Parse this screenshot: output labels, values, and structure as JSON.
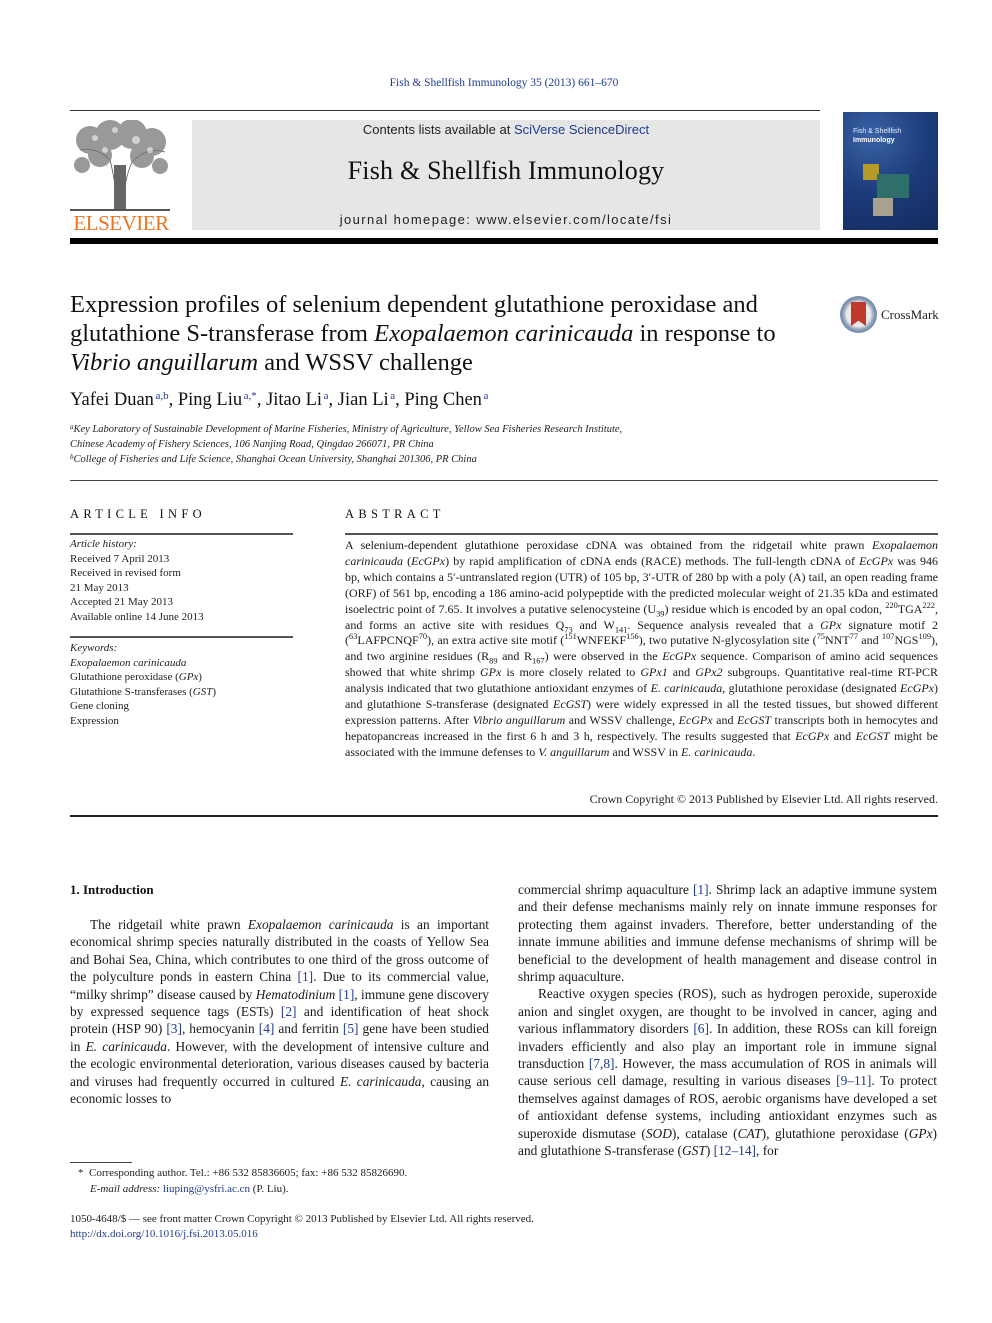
{
  "running_head": "Fish & Shellfish Immunology 35 (2013) 661–670",
  "masthead": {
    "publisher": "ELSEVIER",
    "contents_prefix": "Contents lists available at ",
    "contents_link": "SciVerse ScienceDirect",
    "journal_title": "Fish & Shellfish Immunology",
    "homepage": "journal homepage: www.elsevier.com/locate/fsi",
    "cover_title_line1": "Fish & Shellfish",
    "cover_title_line2": "Immunology"
  },
  "colors": {
    "link": "#1f3b8c",
    "elsevier_orange": "#e87722",
    "masthead_bg": "#e6e6e6",
    "crossmark_red": "#c0392b"
  },
  "crossmark_label": "CrossMark",
  "title": {
    "part1": "Expression profiles of selenium dependent glutathione peroxidase and glutathione S-transferase from ",
    "species1": "Exopalaemon carinicauda",
    "part2": " in response to ",
    "species2": "Vibrio anguillarum",
    "part3": " and WSSV challenge"
  },
  "authors": [
    {
      "name": "Yafei Duan",
      "aff": "a,b"
    },
    {
      "name": "Ping Liu",
      "aff": "a,*"
    },
    {
      "name": "Jitao Li",
      "aff": "a"
    },
    {
      "name": "Jian Li",
      "aff": "a"
    },
    {
      "name": "Ping Chen",
      "aff": "a"
    }
  ],
  "affiliations": [
    {
      "mark": "a",
      "line1": "Key Laboratory of Sustainable Development of Marine Fisheries, Ministry of Agriculture, Yellow Sea Fisheries Research Institute,",
      "line2": "Chinese Academy of Fishery Sciences, 106 Nanjing Road, Qingdao 266071, PR China"
    },
    {
      "mark": "b",
      "line1": "College of Fisheries and Life Science, Shanghai Ocean University, Shanghai 201306, PR China"
    }
  ],
  "article_info": {
    "heading": "ARTICLE INFO",
    "history_label": "Article history:",
    "history": [
      "Received 7 April 2013",
      "Received in revised form",
      "21 May 2013",
      "Accepted 21 May 2013",
      "Available online 14 June 2013"
    ],
    "keywords_label": "Keywords:",
    "keywords": [
      {
        "text": "Exopalaemon carinicauda",
        "italic": true
      },
      {
        "text": "Glutathione peroxidase (",
        "abbr": "GPx",
        "close": ")"
      },
      {
        "text": "Glutathione S-transferases (",
        "abbr": "GST",
        "close": ")"
      },
      {
        "text": "Gene cloning"
      },
      {
        "text": "Expression"
      }
    ]
  },
  "abstract": {
    "heading": "ABSTRACT",
    "html": "A selenium-dependent glutathione peroxidase cDNA was obtained from the ridgetail white prawn <i>Exopalaemon carinicauda</i> (<i>EcGPx</i>) by rapid amplification of cDNA ends (RACE) methods. The full-length cDNA of <i>EcGPx</i> was 946 bp, which contains a 5′-untranslated region (UTR) of 105 bp, 3′-UTR of 280 bp with a poly (A) tail, an open reading frame (ORF) of 561 bp, encoding a 186 amino-acid polypeptide with the predicted molecular weight of 21.35 kDa and estimated isoelectric point of 7.65. It involves a putative selenocysteine (U<sub>39</sub>) residue which is encoded by an opal codon, <sup>220</sup>TGA<sup>222</sup>, and forms an active site with residues Q<sub>73</sub> and W<sub>141</sub>. Sequence analysis revealed that a <i>GPx</i> signature motif 2 (<sup>63</sup>LAFPCNQF<sup>70</sup>), an extra active site motif (<sup>151</sup>WNFEKF<sup>156</sup>), two putative N-glycosylation site (<sup>75</sup>NNT<sup>77</sup> and <sup>107</sup>NGS<sup>109</sup>), and two arginine residues (R<sub>89</sub> and R<sub>167</sub>) were observed in the <i>EcGPx</i> sequence. Comparison of amino acid sequences showed that white shrimp <i>GPx</i> is more closely related to <i>GPx1</i> and <i>GPx2</i> subgroups. Quantitative real-time RT-PCR analysis indicated that two glutathione antioxidant enzymes of <i>E. carinicauda</i>, glutathione peroxidase (designated <i>EcGPx</i>) and glutathione S-transferase (designated <i>EcGST</i>) were widely expressed in all the tested tissues, but showed different expression patterns. After <i>Vibrio anguillarum</i> and WSSV challenge, <i>EcGPx</i> and <i>EcGST</i> transcripts both in hemocytes and hepatopancreas increased in the first 6 h and 3 h, respectively. The results suggested that <i>EcGPx</i> and <i>EcGST</i> might be associated with the immune defenses to <i>V. anguillarum</i> and WSSV in <i>E. carinicauda</i>.",
    "copyright": "Crown Copyright © 2013 Published by Elsevier Ltd. All rights reserved."
  },
  "introduction": {
    "heading": "1.  Introduction",
    "left_html": "The ridgetail white prawn <i>Exopalaemon carinicauda</i> is an important economical shrimp species naturally distributed in the coasts of Yellow Sea and Bohai Sea, China, which contributes to one third of the gross outcome of the polyculture ponds in eastern China <a href=\"#\" data-name=\"citation-link\" data-interactable=\"true\">[1]</a>. Due to its commercial value, “milky shrimp” disease caused by <i>Hematodinium</i> <a href=\"#\" data-name=\"citation-link\" data-interactable=\"true\">[1]</a>, immune gene discovery by expressed sequence tags (ESTs) <a href=\"#\" data-name=\"citation-link\" data-interactable=\"true\">[2]</a> and identification of heat shock protein (HSP 90) <a href=\"#\" data-name=\"citation-link\" data-interactable=\"true\">[3]</a>, hemocyanin <a href=\"#\" data-name=\"citation-link\" data-interactable=\"true\">[4]</a> and ferritin <a href=\"#\" data-name=\"citation-link\" data-interactable=\"true\">[5]</a> gene have been studied in <i>E. carinicauda</i>. However, with the development of intensive culture and the ecologic environmental deterioration, various diseases caused by bacteria and viruses had frequently occurred in cultured <i>E. carinicauda</i>, causing an economic losses to",
    "right_p1_html": "commercial shrimp aquaculture <a href=\"#\" data-name=\"citation-link\" data-interactable=\"true\">[1]</a>. Shrimp lack an adaptive immune system and their defense mechanisms mainly rely on innate immune responses for protecting them against invaders. Therefore, better understanding of the innate immune abilities and immune defense mechanisms of shrimp will be beneficial to the development of health management and disease control in shrimp aquaculture.",
    "right_p2_html": "Reactive oxygen species (ROS), such as hydrogen peroxide, superoxide anion and singlet oxygen, are thought to be involved in cancer, aging and various inflammatory disorders <a href=\"#\" data-name=\"citation-link\" data-interactable=\"true\">[6]</a>. In addition, these ROSs can kill foreign invaders efficiently and also play an important role in immune signal transduction <a href=\"#\" data-name=\"citation-link\" data-interactable=\"true\">[7,8]</a>. However, the mass accumulation of ROS in animals will cause serious cell damage, resulting in various diseases <a href=\"#\" data-name=\"citation-link\" data-interactable=\"true\">[9–11]</a>. To protect themselves against damages of ROS, aerobic organisms have developed a set of antioxidant defense systems, including antioxidant enzymes such as superoxide dismutase (<i>SOD</i>), catalase (<i>CAT</i>), glutathione peroxidase (<i>GPx</i>) and glutathione S-transferase (<i>GST</i>) <a href=\"#\" data-name=\"citation-link\" data-interactable=\"true\">[12–14]</a>, for"
  },
  "footnote": {
    "star": "*",
    "corresponding": "Corresponding author. Tel.: +86 532 85836605; fax: +86 532 85826690.",
    "email_label": "E-mail address:",
    "email": "liuping@ysfri.ac.cn",
    "email_suffix": " (P. Liu)."
  },
  "front_matter": {
    "issn_line": "1050-4648/$ — see front matter Crown Copyright © 2013 Published by Elsevier Ltd. All rights reserved.",
    "doi": "http://dx.doi.org/10.1016/j.fsi.2013.05.016"
  }
}
